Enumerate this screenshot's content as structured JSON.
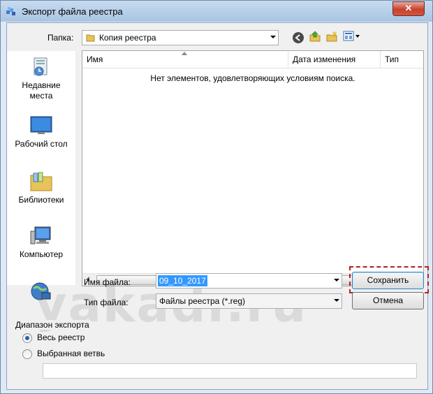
{
  "window": {
    "title": "Экспорт файла реестра",
    "close_glyph": "✕"
  },
  "folder": {
    "label": "Папка:",
    "value": "Копия реестра"
  },
  "places": [
    {
      "name": "recent",
      "label": "Недавние места"
    },
    {
      "name": "desktop",
      "label": "Рабочий стол"
    },
    {
      "name": "libraries",
      "label": "Библиотеки"
    },
    {
      "name": "computer",
      "label": "Компьютер"
    }
  ],
  "list": {
    "columns": [
      "Имя",
      "Дата изменения",
      "Тип"
    ],
    "empty_message": "Нет элементов, удовлетворяющих условиям поиска."
  },
  "filename": {
    "label": "Имя файла:",
    "value": "09_10_2017"
  },
  "filetype": {
    "label": "Тип файла:",
    "value": "Файлы реестра (*.reg)"
  },
  "buttons": {
    "save": "Сохранить",
    "cancel": "Отмена"
  },
  "export_range": {
    "title": "Диапазон экспорта",
    "all_label": "Весь реестр",
    "branch_label": "Выбранная ветвь",
    "branch_value": "",
    "selected": "all"
  },
  "watermark": "yakadr.ru",
  "colors": {
    "accent": "#3399ff",
    "selection": "#3399ff",
    "highlight_frame": "#b3202a"
  }
}
